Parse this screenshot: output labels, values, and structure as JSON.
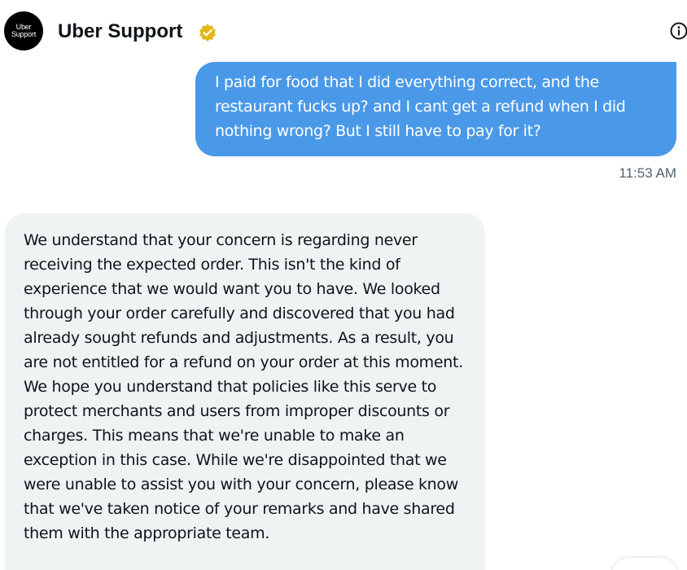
{
  "header": {
    "avatar_line1": "Uber",
    "avatar_line2": "Support",
    "contact_name": "Uber Support",
    "verified_badge_icon": "verified-badge-icon",
    "info_icon": "info-icon"
  },
  "messages": [
    {
      "direction": "sent",
      "text": "I paid for food that I did everything correct, and the restaurant fucks up? and I cant get a refund when I did nothing wrong? But I still have to pay for it?",
      "time": "11:53 AM"
    },
    {
      "direction": "received",
      "text": "We understand that your concern is regarding never receiving the expected order. This isn't the kind of experience that we would want you to have. We looked through your order carefully and discovered that you had already sought refunds and adjustments. As a result, you are not entitled for a refund on your order at this moment. We hope you understand that policies like this serve to protect merchants and users from improper discounts or charges. This means that we're unable to make an exception in this case. While we're disappointed that we were unable to assist you with your concern, please know that we've taken notice of your remarks and have shared them with the appropriate team."
    }
  ],
  "colors": {
    "sent_bubble": "#4a99e9",
    "received_bubble": "#eff3f4",
    "verified_badge": "#e2b719",
    "text_primary": "#0f1419",
    "text_secondary": "#536471"
  }
}
